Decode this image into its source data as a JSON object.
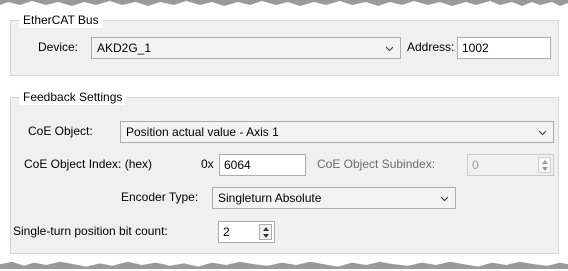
{
  "ethercat_bus": {
    "title": "EtherCAT Bus",
    "device_label": "Device:",
    "device_value": "AKD2G_1",
    "address_label": "Address:",
    "address_value": "1002"
  },
  "feedback_settings": {
    "title": "Feedback Settings",
    "coe_object_label": "CoE Object:",
    "coe_object_value": "Position actual value - Axis 1",
    "coe_index_label": "CoE Object Index: (hex)",
    "coe_index_prefix": "0x",
    "coe_index_value": "6064",
    "coe_subindex_label": "CoE Object Subindex:",
    "coe_subindex_value": "0",
    "encoder_type_label": "Encoder Type:",
    "encoder_type_value": "Singleturn Absolute",
    "bit_count_label": "Single-turn position bit count:",
    "bit_count_value": "2"
  },
  "icons": {
    "dropdown": "chevron-down-icon",
    "spinner": "spin-arrows-icon"
  },
  "colors": {
    "panel_bg": "#f0f0f0",
    "border": "#adadad",
    "disabled_text": "#a0a0a0"
  }
}
